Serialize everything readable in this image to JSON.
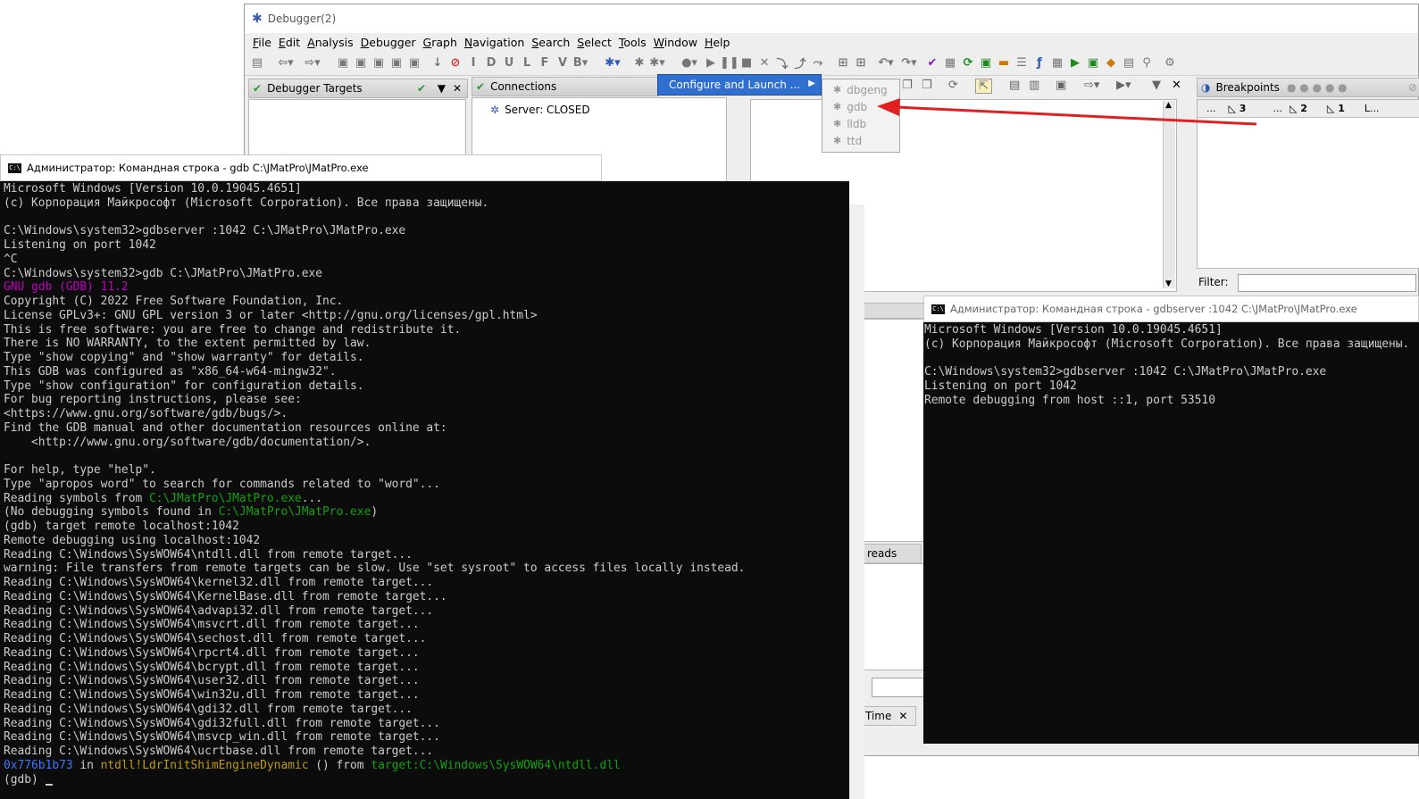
{
  "debugger": {
    "title": "Debugger(2)",
    "menu": [
      "File",
      "Edit",
      "Analysis",
      "Debugger",
      "Graph",
      "Navigation",
      "Search",
      "Select",
      "Tools",
      "Window",
      "Help"
    ],
    "panels": {
      "targets": "Debugger Targets",
      "connections": "Connections",
      "server_status": "Server: CLOSED",
      "breakpoints": "Breakpoints",
      "bp_cols": [
        "...",
        "3",
        "...",
        "2",
        "1",
        "L..."
      ],
      "filter_label": "Filter:",
      "threads_fragment": "reads",
      "time_tab": "Time"
    },
    "popup": {
      "configure": "Configure and Launch ...",
      "submenu": [
        "dbgeng",
        "gdb",
        "lldb",
        "ttd"
      ]
    }
  },
  "console1": {
    "title": "Администратор: Командная строка - gdb  C:\\JMatPro\\JMatPro.exe",
    "lines": [
      [
        {
          "t": "Microsoft Windows [Version 10.0.19045.4651]"
        }
      ],
      [
        {
          "t": "(c) Корпорация Майкрософт (Microsoft Corporation). Все права защищены."
        }
      ],
      [
        {
          "t": ""
        }
      ],
      [
        {
          "t": "C:\\Windows\\system32>gdbserver :1042 C:\\JMatPro\\JMatPro.exe"
        }
      ],
      [
        {
          "t": "Listening on port 1042"
        }
      ],
      [
        {
          "t": "^C"
        }
      ],
      [
        {
          "t": "C:\\Windows\\system32>gdb C:\\JMatPro\\JMatPro.exe"
        }
      ],
      [
        {
          "t": "GNU gdb (GDB) 11.2",
          "c": "magenta"
        }
      ],
      [
        {
          "t": "Copyright (C) 2022 Free Software Foundation, Inc."
        }
      ],
      [
        {
          "t": "License GPLv3+: GNU GPL version 3 or later <http://gnu.org/licenses/gpl.html>"
        }
      ],
      [
        {
          "t": "This is free software: you are free to change and redistribute it."
        }
      ],
      [
        {
          "t": "There is NO WARRANTY, to the extent permitted by law."
        }
      ],
      [
        {
          "t": "Type \"show copying\" and \"show warranty\" for details."
        }
      ],
      [
        {
          "t": "This GDB was configured as \"x86_64-w64-mingw32\"."
        }
      ],
      [
        {
          "t": "Type \"show configuration\" for configuration details."
        }
      ],
      [
        {
          "t": "For bug reporting instructions, please see:"
        }
      ],
      [
        {
          "t": "<https://www.gnu.org/software/gdb/bugs/>."
        }
      ],
      [
        {
          "t": "Find the GDB manual and other documentation resources online at:"
        }
      ],
      [
        {
          "t": "    <http://www.gnu.org/software/gdb/documentation/>."
        }
      ],
      [
        {
          "t": ""
        }
      ],
      [
        {
          "t": "For help, type \"help\"."
        }
      ],
      [
        {
          "t": "Type \"apropos word\" to search for commands related to \"word\"..."
        }
      ],
      [
        {
          "t": "Reading symbols from "
        },
        {
          "t": "C:\\JMatPro\\JMatPro.exe",
          "c": "green"
        },
        {
          "t": "..."
        }
      ],
      [
        {
          "t": "(No debugging symbols found in "
        },
        {
          "t": "C:\\JMatPro\\JMatPro.exe",
          "c": "green"
        },
        {
          "t": ")"
        }
      ],
      [
        {
          "t": "(gdb) target remote localhost:1042"
        }
      ],
      [
        {
          "t": "Remote debugging using localhost:1042"
        }
      ],
      [
        {
          "t": "Reading C:\\Windows\\SysWOW64\\ntdll.dll from remote target..."
        }
      ],
      [
        {
          "t": "warning: File transfers from remote targets can be slow. Use \"set sysroot\" to access files locally instead."
        }
      ],
      [
        {
          "t": "Reading C:\\Windows\\SysWOW64\\kernel32.dll from remote target..."
        }
      ],
      [
        {
          "t": "Reading C:\\Windows\\SysWOW64\\KernelBase.dll from remote target..."
        }
      ],
      [
        {
          "t": "Reading C:\\Windows\\SysWOW64\\advapi32.dll from remote target..."
        }
      ],
      [
        {
          "t": "Reading C:\\Windows\\SysWOW64\\msvcrt.dll from remote target..."
        }
      ],
      [
        {
          "t": "Reading C:\\Windows\\SysWOW64\\sechost.dll from remote target..."
        }
      ],
      [
        {
          "t": "Reading C:\\Windows\\SysWOW64\\rpcrt4.dll from remote target..."
        }
      ],
      [
        {
          "t": "Reading C:\\Windows\\SysWOW64\\bcrypt.dll from remote target..."
        }
      ],
      [
        {
          "t": "Reading C:\\Windows\\SysWOW64\\user32.dll from remote target..."
        }
      ],
      [
        {
          "t": "Reading C:\\Windows\\SysWOW64\\win32u.dll from remote target..."
        }
      ],
      [
        {
          "t": "Reading C:\\Windows\\SysWOW64\\gdi32.dll from remote target..."
        }
      ],
      [
        {
          "t": "Reading C:\\Windows\\SysWOW64\\gdi32full.dll from remote target..."
        }
      ],
      [
        {
          "t": "Reading C:\\Windows\\SysWOW64\\msvcp_win.dll from remote target..."
        }
      ],
      [
        {
          "t": "Reading C:\\Windows\\SysWOW64\\ucrtbase.dll from remote target..."
        }
      ],
      [
        {
          "t": "0x776b1b73",
          "c": "blue"
        },
        {
          "t": " in "
        },
        {
          "t": "ntdll!LdrInitShimEngineDynamic",
          "c": "yellow"
        },
        {
          "t": " () from "
        },
        {
          "t": "target:C:\\Windows\\SysWOW64\\ntdll.dll",
          "c": "green"
        }
      ],
      [
        {
          "t": "(gdb) "
        },
        {
          "cursor": true
        }
      ]
    ]
  },
  "console2": {
    "title": "Администратор: Командная строка - gdbserver :1042 C:\\JMatPro\\JMatPro.exe",
    "lines": [
      [
        {
          "t": "Microsoft Windows [Version 10.0.19045.4651]"
        }
      ],
      [
        {
          "t": "(c) Корпорация Майкрософт (Microsoft Corporation). Все права защищены."
        }
      ],
      [
        {
          "t": ""
        }
      ],
      [
        {
          "t": "C:\\Windows\\system32>gdbserver :1042 C:\\JMatPro\\JMatPro.exe"
        }
      ],
      [
        {
          "t": "Listening on port 1042"
        }
      ],
      [
        {
          "t": "Remote debugging from host ::1, port 53510"
        }
      ]
    ]
  }
}
